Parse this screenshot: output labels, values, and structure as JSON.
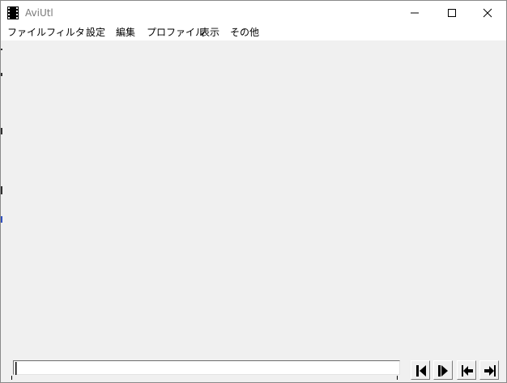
{
  "window": {
    "title": "AviUtl"
  },
  "menubar": {
    "items": [
      {
        "label": "ファイル"
      },
      {
        "label": "フィルタ"
      },
      {
        "label": "設定"
      },
      {
        "label": "編集"
      },
      {
        "label": "プロファイル"
      },
      {
        "label": "表示"
      },
      {
        "label": "その他"
      }
    ]
  },
  "icons": {
    "app": "film-strip-icon",
    "minimize": "minimize-icon",
    "maximize": "maximize-icon",
    "close": "close-icon",
    "prev_frame": "previous-frame-icon",
    "next_frame": "next-frame-icon",
    "first_frame": "first-frame-icon",
    "last_frame": "last-frame-icon"
  },
  "seekbar": {
    "position": 0
  },
  "colors": {
    "client_background": "#f0f0f0",
    "title_text": "#7a7a7a"
  }
}
